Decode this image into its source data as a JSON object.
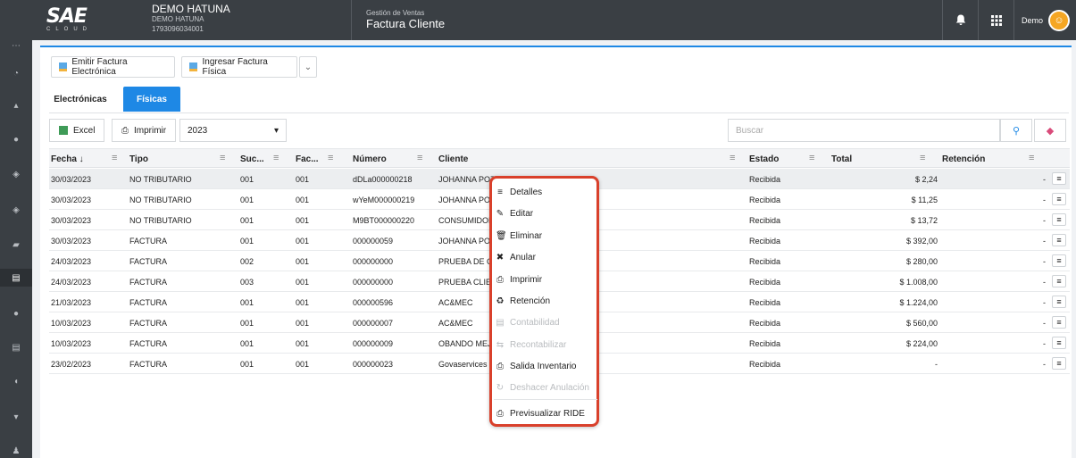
{
  "topbar": {
    "logo_main": "SAE",
    "logo_sub": "CLOUD",
    "company_name": "DEMO HATUNA",
    "company_sub": "DEMO HATUNA",
    "company_ruc": "1793096034001",
    "module_section": "Gestión de Ventas",
    "module_title": "Factura Cliente",
    "user_name": "Demo"
  },
  "actions": {
    "emitir": "Emitir Factura Electrónica",
    "ingresar": "Ingresar Factura Física"
  },
  "tabs": [
    "Electrónicas",
    "Físicas"
  ],
  "toolbar": {
    "excel": "Excel",
    "imprimir": "Imprimir",
    "year": "2023",
    "search_placeholder": "Buscar"
  },
  "columns": [
    "Fecha ↓",
    "Tipo",
    "Suc...",
    "Fac...",
    "Número",
    "Cliente",
    "Estado",
    "Total",
    "Retención"
  ],
  "rows": [
    {
      "fecha": "30/03/2023",
      "tipo": "NO TRIBUTARIO",
      "suc": "001",
      "fac": "001",
      "numero": "dDLa000000218",
      "cliente": "JOHANNA POZO",
      "estado": "Recibida",
      "total": "$ 2,24",
      "ret": "-"
    },
    {
      "fecha": "30/03/2023",
      "tipo": "NO TRIBUTARIO",
      "suc": "001",
      "fac": "001",
      "numero": "wYeM000000219",
      "cliente": "JOHANNA POZO",
      "estado": "Recibida",
      "total": "$ 11,25",
      "ret": "-"
    },
    {
      "fecha": "30/03/2023",
      "tipo": "NO TRIBUTARIO",
      "suc": "001",
      "fac": "001",
      "numero": "M9BT000000220",
      "cliente": "CONSUMIDOR",
      "estado": "Recibida",
      "total": "$ 13,72",
      "ret": "-"
    },
    {
      "fecha": "30/03/2023",
      "tipo": "FACTURA",
      "suc": "001",
      "fac": "001",
      "numero": "000000059",
      "cliente": "JOHANNA POZO",
      "estado": "Recibida",
      "total": "$ 392,00",
      "ret": "-"
    },
    {
      "fecha": "24/03/2023",
      "tipo": "FACTURA",
      "suc": "002",
      "fac": "001",
      "numero": "000000000",
      "cliente": "PRUEBA DE CL",
      "estado": "Recibida",
      "total": "$ 280,00",
      "ret": "-"
    },
    {
      "fecha": "24/03/2023",
      "tipo": "FACTURA",
      "suc": "003",
      "fac": "001",
      "numero": "000000000",
      "cliente": "PRUEBA CLIEN",
      "estado": "Recibida",
      "total": "$ 1.008,00",
      "ret": "-"
    },
    {
      "fecha": "21/03/2023",
      "tipo": "FACTURA",
      "suc": "001",
      "fac": "001",
      "numero": "000000596",
      "cliente": "AC&MEC",
      "estado": "Recibida",
      "total": "$ 1.224,00",
      "ret": "-"
    },
    {
      "fecha": "10/03/2023",
      "tipo": "FACTURA",
      "suc": "001",
      "fac": "001",
      "numero": "000000007",
      "cliente": "AC&MEC",
      "estado": "Recibida",
      "total": "$ 560,00",
      "ret": "-"
    },
    {
      "fecha": "10/03/2023",
      "tipo": "FACTURA",
      "suc": "001",
      "fac": "001",
      "numero": "000000009",
      "cliente": "OBANDO MEJI",
      "estado": "Recibida",
      "total": "$ 224,00",
      "ret": "-"
    },
    {
      "fecha": "23/02/2023",
      "tipo": "FACTURA",
      "suc": "001",
      "fac": "001",
      "numero": "000000023",
      "cliente": "Govaservices",
      "estado": "Recibida",
      "total": "-",
      "ret": "-"
    }
  ],
  "context_menu": [
    {
      "label": "Detalles",
      "icon": "≡",
      "disabled": false
    },
    {
      "label": "Editar",
      "icon": "✎",
      "disabled": false
    },
    {
      "label": "Eliminar",
      "icon": "🗑",
      "disabled": false
    },
    {
      "label": "Anular",
      "icon": "✖",
      "disabled": false
    },
    {
      "label": "Imprimir",
      "icon": "⎙",
      "disabled": false
    },
    {
      "label": "Retención",
      "icon": "♻",
      "disabled": false
    },
    {
      "label": "Contabilidad",
      "icon": "▤",
      "disabled": true
    },
    {
      "label": "Recontabilizar",
      "icon": "⇆",
      "disabled": true
    },
    {
      "label": "Salida Inventario",
      "icon": "⎙",
      "disabled": false
    },
    {
      "label": "Deshacer Anulación",
      "icon": "↻",
      "disabled": true
    },
    {
      "label": "Previsualizar RIDE",
      "icon": "⎙",
      "disabled": false
    }
  ],
  "colors": {
    "accent": "#1e88e5",
    "topbar": "#3a3f44",
    "highlight": "#d9402b"
  }
}
